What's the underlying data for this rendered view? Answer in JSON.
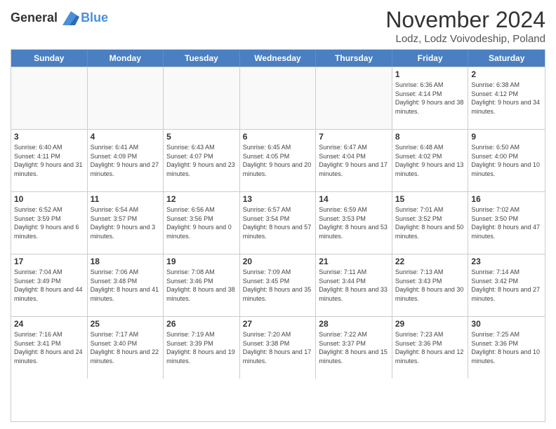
{
  "logo": {
    "line1": "General",
    "line2": "Blue"
  },
  "title": "November 2024",
  "subtitle": "Lodz, Lodz Voivodeship, Poland",
  "days_of_week": [
    "Sunday",
    "Monday",
    "Tuesday",
    "Wednesday",
    "Thursday",
    "Friday",
    "Saturday"
  ],
  "weeks": [
    [
      {
        "day": "",
        "empty": true
      },
      {
        "day": "",
        "empty": true
      },
      {
        "day": "",
        "empty": true
      },
      {
        "day": "",
        "empty": true
      },
      {
        "day": "",
        "empty": true
      },
      {
        "day": "1",
        "sunrise": "Sunrise: 6:36 AM",
        "sunset": "Sunset: 4:14 PM",
        "daylight": "Daylight: 9 hours and 38 minutes."
      },
      {
        "day": "2",
        "sunrise": "Sunrise: 6:38 AM",
        "sunset": "Sunset: 4:12 PM",
        "daylight": "Daylight: 9 hours and 34 minutes."
      }
    ],
    [
      {
        "day": "3",
        "sunrise": "Sunrise: 6:40 AM",
        "sunset": "Sunset: 4:11 PM",
        "daylight": "Daylight: 9 hours and 31 minutes."
      },
      {
        "day": "4",
        "sunrise": "Sunrise: 6:41 AM",
        "sunset": "Sunset: 4:09 PM",
        "daylight": "Daylight: 9 hours and 27 minutes."
      },
      {
        "day": "5",
        "sunrise": "Sunrise: 6:43 AM",
        "sunset": "Sunset: 4:07 PM",
        "daylight": "Daylight: 9 hours and 23 minutes."
      },
      {
        "day": "6",
        "sunrise": "Sunrise: 6:45 AM",
        "sunset": "Sunset: 4:05 PM",
        "daylight": "Daylight: 9 hours and 20 minutes."
      },
      {
        "day": "7",
        "sunrise": "Sunrise: 6:47 AM",
        "sunset": "Sunset: 4:04 PM",
        "daylight": "Daylight: 9 hours and 17 minutes."
      },
      {
        "day": "8",
        "sunrise": "Sunrise: 6:48 AM",
        "sunset": "Sunset: 4:02 PM",
        "daylight": "Daylight: 9 hours and 13 minutes."
      },
      {
        "day": "9",
        "sunrise": "Sunrise: 6:50 AM",
        "sunset": "Sunset: 4:00 PM",
        "daylight": "Daylight: 9 hours and 10 minutes."
      }
    ],
    [
      {
        "day": "10",
        "sunrise": "Sunrise: 6:52 AM",
        "sunset": "Sunset: 3:59 PM",
        "daylight": "Daylight: 9 hours and 6 minutes."
      },
      {
        "day": "11",
        "sunrise": "Sunrise: 6:54 AM",
        "sunset": "Sunset: 3:57 PM",
        "daylight": "Daylight: 9 hours and 3 minutes."
      },
      {
        "day": "12",
        "sunrise": "Sunrise: 6:56 AM",
        "sunset": "Sunset: 3:56 PM",
        "daylight": "Daylight: 9 hours and 0 minutes."
      },
      {
        "day": "13",
        "sunrise": "Sunrise: 6:57 AM",
        "sunset": "Sunset: 3:54 PM",
        "daylight": "Daylight: 8 hours and 57 minutes."
      },
      {
        "day": "14",
        "sunrise": "Sunrise: 6:59 AM",
        "sunset": "Sunset: 3:53 PM",
        "daylight": "Daylight: 8 hours and 53 minutes."
      },
      {
        "day": "15",
        "sunrise": "Sunrise: 7:01 AM",
        "sunset": "Sunset: 3:52 PM",
        "daylight": "Daylight: 8 hours and 50 minutes."
      },
      {
        "day": "16",
        "sunrise": "Sunrise: 7:02 AM",
        "sunset": "Sunset: 3:50 PM",
        "daylight": "Daylight: 8 hours and 47 minutes."
      }
    ],
    [
      {
        "day": "17",
        "sunrise": "Sunrise: 7:04 AM",
        "sunset": "Sunset: 3:49 PM",
        "daylight": "Daylight: 8 hours and 44 minutes."
      },
      {
        "day": "18",
        "sunrise": "Sunrise: 7:06 AM",
        "sunset": "Sunset: 3:48 PM",
        "daylight": "Daylight: 8 hours and 41 minutes."
      },
      {
        "day": "19",
        "sunrise": "Sunrise: 7:08 AM",
        "sunset": "Sunset: 3:46 PM",
        "daylight": "Daylight: 8 hours and 38 minutes."
      },
      {
        "day": "20",
        "sunrise": "Sunrise: 7:09 AM",
        "sunset": "Sunset: 3:45 PM",
        "daylight": "Daylight: 8 hours and 35 minutes."
      },
      {
        "day": "21",
        "sunrise": "Sunrise: 7:11 AM",
        "sunset": "Sunset: 3:44 PM",
        "daylight": "Daylight: 8 hours and 33 minutes."
      },
      {
        "day": "22",
        "sunrise": "Sunrise: 7:13 AM",
        "sunset": "Sunset: 3:43 PM",
        "daylight": "Daylight: 8 hours and 30 minutes."
      },
      {
        "day": "23",
        "sunrise": "Sunrise: 7:14 AM",
        "sunset": "Sunset: 3:42 PM",
        "daylight": "Daylight: 8 hours and 27 minutes."
      }
    ],
    [
      {
        "day": "24",
        "sunrise": "Sunrise: 7:16 AM",
        "sunset": "Sunset: 3:41 PM",
        "daylight": "Daylight: 8 hours and 24 minutes."
      },
      {
        "day": "25",
        "sunrise": "Sunrise: 7:17 AM",
        "sunset": "Sunset: 3:40 PM",
        "daylight": "Daylight: 8 hours and 22 minutes."
      },
      {
        "day": "26",
        "sunrise": "Sunrise: 7:19 AM",
        "sunset": "Sunset: 3:39 PM",
        "daylight": "Daylight: 8 hours and 19 minutes."
      },
      {
        "day": "27",
        "sunrise": "Sunrise: 7:20 AM",
        "sunset": "Sunset: 3:38 PM",
        "daylight": "Daylight: 8 hours and 17 minutes."
      },
      {
        "day": "28",
        "sunrise": "Sunrise: 7:22 AM",
        "sunset": "Sunset: 3:37 PM",
        "daylight": "Daylight: 8 hours and 15 minutes."
      },
      {
        "day": "29",
        "sunrise": "Sunrise: 7:23 AM",
        "sunset": "Sunset: 3:36 PM",
        "daylight": "Daylight: 8 hours and 12 minutes."
      },
      {
        "day": "30",
        "sunrise": "Sunrise: 7:25 AM",
        "sunset": "Sunset: 3:36 PM",
        "daylight": "Daylight: 8 hours and 10 minutes."
      }
    ]
  ]
}
